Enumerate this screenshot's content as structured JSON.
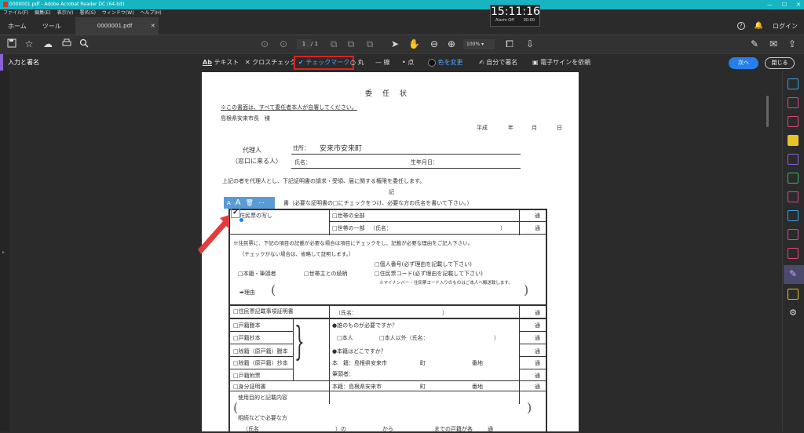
{
  "window": {
    "title": "0000001.pdf - Adobe Acrobat Reader DC (64-bit)"
  },
  "menu": [
    "ファイル(F)",
    "編集(E)",
    "表示(V)",
    "署名(S)",
    "ウィンドウ(W)",
    "ヘルプ(H)"
  ],
  "tabs": {
    "home": "ホーム",
    "tools": "ツール",
    "document": "0000001.pdf"
  },
  "account": {
    "login": "ログイン"
  },
  "clock": {
    "time": "15:11:16",
    "alarm": "Alarm Off",
    "count": "00:00"
  },
  "toolbar": {
    "page_current": "1",
    "page_total": "/ 1",
    "zoom": "100%"
  },
  "fill_sign": {
    "title": "入力と署名",
    "items": [
      "テキスト",
      "クロスチェック",
      "チェックマーク",
      "丸",
      "線",
      "点",
      "色を変更",
      "自分で署名",
      "電子サインを依頼"
    ],
    "text_icon": "Ab",
    "next": "次へ",
    "close": "閉じる"
  },
  "document": {
    "heading": "委　任　状",
    "note_top": "※この書面は、すべて委任者本人が自署してください。",
    "addressee": "島根県安来市長　様",
    "date": [
      "平成",
      "年",
      "月",
      "日"
    ],
    "agent_label": "代理人",
    "agent_sub": "（窓口に来る人）",
    "address_label": "住所：",
    "address_value": "安来市安来町",
    "name_label": "氏名：",
    "birth_label": "生年月日：",
    "delegation": "上記の者を代理人とし、下記証明書の請求・受領、届に関する権限を委任します。",
    "ki": "記",
    "cert_header": "書（必要な証明書の□にチェックをつけ、必要な方の氏名を書いて下さい。）",
    "row1_label": "住民票の写し",
    "row1_all": "□世帯の全部",
    "row1_part": "□世帯の一部",
    "row1_part_name": "（氏名：",
    "paren_close": "）",
    "count_suffix": "通",
    "juminhyo_note1": "※住民票に、下記の項目の記載が必要な場合は項目にチェックをし、記載が必要な理由をご記入下さい。",
    "juminhyo_note2": "（チェックがない場合は、省略して証明します。）",
    "my_number": "□個人番号(必ず理由を記載して下さい)",
    "resident_code": "□住民票コード(必ず理由を記載して下さい)",
    "honseki": "□本籍・筆頭者",
    "relation": "□世帯主との続柄",
    "mynumber_note": "※マイナンバー・住民票コード入りのものはご本人へ郵送致します。",
    "reason": "理由",
    "kisai_jiko": "□住民票記載事項証明書",
    "kisai_name": "（氏名：",
    "koseki": [
      "□戸籍謄本",
      "□戸籍抄本",
      "□除籍（原戸籍）謄本",
      "□除籍（原戸籍）抄本",
      "□戸籍附票"
    ],
    "whose_q": "●誰のものが必要ですか？",
    "self": "□本人",
    "other": "□本人以外（氏名：",
    "where_q": "●本籍はどこですか？",
    "honseki_line": "本　籍：島根県安来市",
    "town": "町",
    "banchi": "番地",
    "hittosha": "筆頭者：",
    "mibun": "□身分証明書",
    "mibun_honseki": "本籍：島根県安来市",
    "purpose": "使用目的と記載内容",
    "soku": "相続などで必要な方",
    "from_to": [
      "（氏名",
      "）の",
      "から",
      "までの戸籍が各",
      "通"
    ]
  }
}
